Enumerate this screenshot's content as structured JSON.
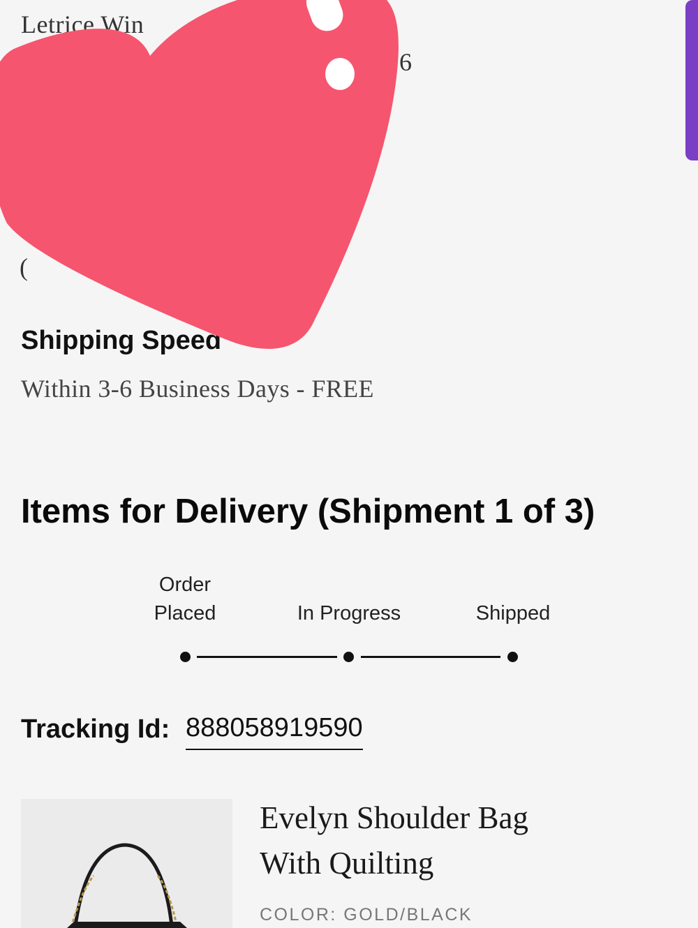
{
  "address": {
    "name": "Letrice Win",
    "line_fragment": "6",
    "phone_fragment": "("
  },
  "sticker": {
    "icon": "heart-sticker",
    "color": "#f5556e"
  },
  "side_tab": {
    "color": "#7a3fc4"
  },
  "shipping": {
    "heading": "Shipping Speed",
    "value": "Within 3-6 Business Days - FREE"
  },
  "items": {
    "heading": "Items for Delivery (Shipment 1 of 3)"
  },
  "progress": {
    "steps": [
      {
        "line1": "Order",
        "line2": "Placed"
      },
      {
        "line1": "",
        "line2": "In Progress"
      },
      {
        "line1": "",
        "line2": "Shipped"
      }
    ]
  },
  "tracking": {
    "label": "Tracking Id:",
    "id": "888058919590"
  },
  "product": {
    "name_line1": "Evelyn Shoulder Bag",
    "name_line2": "With Quilting",
    "color": "COLOR: GOLD/BLACK",
    "image_icon": "shoulder-bag-image"
  }
}
